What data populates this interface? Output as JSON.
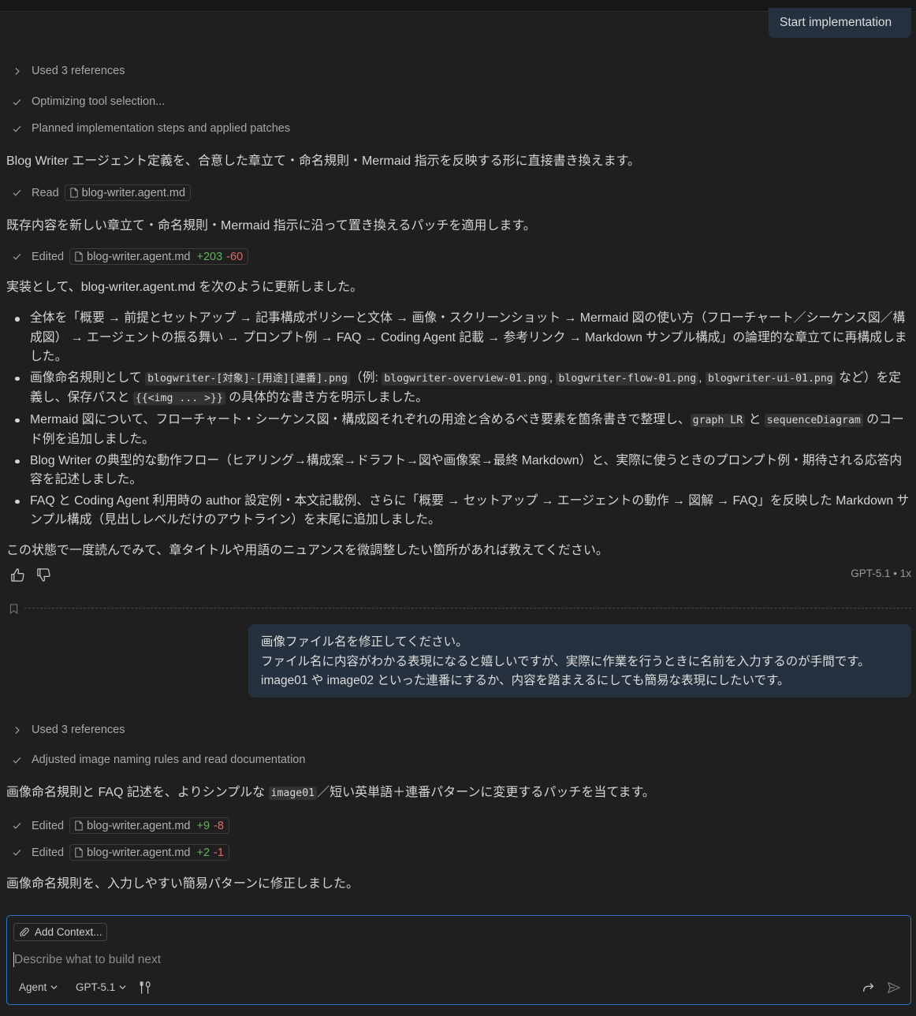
{
  "first_prompt": {
    "text": "Start implementation"
  },
  "turn1": {
    "used_refs": "Used 3 references",
    "step1": "Optimizing tool selection...",
    "step2": "Planned implementation steps and applied patches",
    "intro": "Blog Writer エージェント定義を、合意した章立て・命名規則・Mermaid 指示を反映する形に直接書き換えます。",
    "read_label": "Read",
    "read_file": "blog-writer.agent.md",
    "patch_note": "既存内容を新しい章立て・命名規則・Mermaid 指示に沿って置き換えるパッチを適用します。",
    "edit_label": "Edited",
    "edit_file": "blog-writer.agent.md",
    "edit_plus": "+203",
    "edit_minus": "-60",
    "summary": "実装として、blog-writer.agent.md を次のように更新しました。",
    "b1": "全体を「概要 → 前提とセットアップ → 記事構成ポリシーと文体 → 画像・スクリーンショット → Mermaid 図の使い方（フローチャート／シーケンス図／構成図） → エージェントの振る舞い → プロンプト例 → FAQ → Coding Agent 記載 → 参考リンク → Markdown サンプル構成」の論理的な章立てに再構成しました。",
    "b2": {
      "t1": "画像命名規則として ",
      "c1": "blogwriter-[対象]-[用途][連番].png",
      "t2": "（例: ",
      "c2": "blogwriter-overview-01.png",
      "t3": ", ",
      "c3": "blogwriter-flow-01.png",
      "t4": ", ",
      "c4": "blogwriter-ui-01.png",
      "t5": " など）を定義し、保存パスと ",
      "c5": "{{<img ... >}}",
      "t6": " の具体的な書き方を明示しました。"
    },
    "b3": {
      "t1": "Mermaid 図について、フローチャート・シーケンス図・構成図それぞれの用途と含めるべき要素を箇条書きで整理し、",
      "c1": "graph LR",
      "t2": " と ",
      "c2": "sequenceDiagram",
      "t3": " のコード例を追加しました。"
    },
    "b4": "Blog Writer の典型的な動作フロー（ヒアリング→構成案→ドラフト→図や画像案→最終 Markdown）と、実際に使うときのプロンプト例・期待される応答内容を記述しました。",
    "b5": "FAQ と Coding Agent 利用時の author 設定例・本文記載例、さらに「概要 → セットアップ → エージェントの動作 → 図解 → FAQ」を反映した Markdown サンプル構成（見出しレベルだけのアウトライン）を末尾に追加しました。",
    "closing": "この状態で一度読んでみて、章タイトルや用語のニュアンスを微調整したい箇所があれば教えてください。",
    "model": "GPT-5.1 • 1x"
  },
  "second_prompt": {
    "line1": "画像ファイル名を修正してください。",
    "line2": "ファイル名に内容がわかる表現になると嬉しいですが、実際に作業を行うときに名前を入力するのが手間です。",
    "line3": "image01 や image02 といった連番にするか、内容を踏まえるにしても簡易な表現にしたいです。"
  },
  "turn2": {
    "used_refs": "Used 3 references",
    "step1": "Adjusted image naming rules and read documentation",
    "intro_t1": "画像命名規則と FAQ 記述を、よりシンプルな ",
    "intro_code": "image01",
    "intro_t2": "／短い英単語＋連番パターンに変更するパッチを当てます。",
    "edit1_label": "Edited",
    "edit1_file": "blog-writer.agent.md",
    "edit1_plus": "+9",
    "edit1_minus": "-8",
    "edit2_label": "Edited",
    "edit2_file": "blog-writer.agent.md",
    "edit2_plus": "+2",
    "edit2_minus": "-1",
    "closing": "画像命名規則を、入力しやすい簡易パターンに修正しました。"
  },
  "composer": {
    "add_context": "Add Context...",
    "placeholder": "Describe what to build next",
    "mode": "Agent",
    "model": "GPT-5.1"
  },
  "colors": {
    "accent": "#2f73c9",
    "added": "#5fb35f",
    "removed": "#e06b6b",
    "bubble": "#26313f"
  },
  "icons": [
    "chevron-right-icon",
    "check-icon",
    "file-icon",
    "thumbs-up-icon",
    "thumbs-down-icon",
    "bookmark-icon",
    "paperclip-icon",
    "chevron-down-icon",
    "tools-icon",
    "redo-icon",
    "send-icon"
  ]
}
